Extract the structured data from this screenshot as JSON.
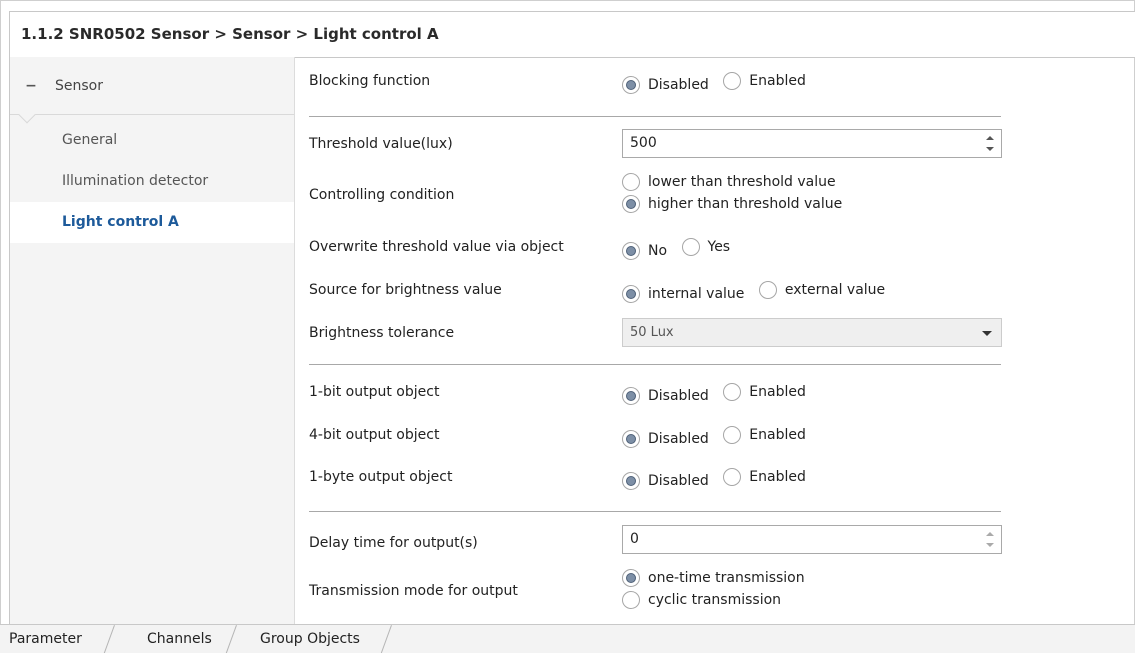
{
  "title": "1.1.2 SNR0502 Sensor > Sensor > Light control A",
  "sidebar": {
    "group": "Sensor",
    "items": [
      {
        "label": "General",
        "active": false
      },
      {
        "label": "Illumination detector",
        "active": false
      },
      {
        "label": "Light control A",
        "active": true
      }
    ]
  },
  "params": {
    "blocking": {
      "label": "Blocking function",
      "options": [
        "Disabled",
        "Enabled"
      ],
      "selected": "Disabled"
    },
    "threshold": {
      "label": "Threshold value(lux)",
      "value": "500"
    },
    "condition": {
      "label": "Controlling condition",
      "options": [
        "lower than threshold value",
        "higher than threshold value"
      ],
      "selected": "higher than threshold value"
    },
    "overwrite": {
      "label": "Overwrite threshold value via object",
      "options": [
        "No",
        "Yes"
      ],
      "selected": "No"
    },
    "source": {
      "label": "Source for brightness value",
      "options": [
        "internal value",
        "external value"
      ],
      "selected": "internal value"
    },
    "tolerance": {
      "label": "Brightness tolerance",
      "value": "50 Lux"
    },
    "out1bit": {
      "label": "1-bit output object",
      "options": [
        "Disabled",
        "Enabled"
      ],
      "selected": "Disabled"
    },
    "out4bit": {
      "label": "4-bit output object",
      "options": [
        "Disabled",
        "Enabled"
      ],
      "selected": "Disabled"
    },
    "out1byte": {
      "label": "1-byte output object",
      "options": [
        "Disabled",
        "Enabled"
      ],
      "selected": "Disabled"
    },
    "delay": {
      "label": "Delay time for output(s)",
      "value": "0"
    },
    "transmission": {
      "label": "Transmission mode for output",
      "options": [
        "one-time transmission",
        "cyclic transmission"
      ],
      "selected": "one-time transmission"
    }
  },
  "tabs": [
    "Parameter",
    "Channels",
    "Group Objects"
  ],
  "icons": {
    "collapse": "minus-icon",
    "spin": "spin-arrows-icon",
    "dropdown": "chevron-down-icon"
  },
  "colors": {
    "active_nav": "#1d5a9a",
    "radio_dot": "#7d8fa6"
  }
}
